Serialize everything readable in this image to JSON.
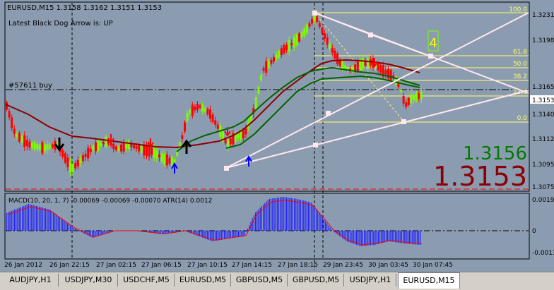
{
  "chart_header": {
    "symbol_line": "EURUSD,M15  1.3158 1.3162 1.3151 1.3153",
    "indicator_text": "Latest Black Dog Arrow is:  UP",
    "order_label": "#57611 buy"
  },
  "price_axis": {
    "ticks": [
      "1.3231",
      "1.3198",
      "1.3165",
      "1.3140",
      "1.3112",
      "1.3095",
      "1.3075"
    ],
    "current_price_tag": "1.3153"
  },
  "big_prices": {
    "bid": "1.3156",
    "ask": "1.3153"
  },
  "fibonacci": {
    "levels": [
      "100.0",
      "61.8",
      "50.0",
      "38.2",
      "23.6",
      "0.0"
    ]
  },
  "wave_label": "4",
  "macd_panel": {
    "label": "MACD(10, 20, 1, 7) -0.00069 -0.00069 -0.00070  ATR(14) 0.0012",
    "ticks": [
      "0.0019",
      "0",
      "-0.0013"
    ]
  },
  "time_axis": {
    "labels": [
      "26 Jan 2012",
      "26 Jan 22:15",
      "27 Jan 02:15",
      "27 Jan 06:15",
      "27 Jan 10:15",
      "27 Jan 14:15",
      "27 Jan 18:15",
      "29 Jan 23:45",
      "30 Jan 03:45",
      "30 Jan 07:45"
    ]
  },
  "tabs": [
    {
      "label": "AUDJPY,H1",
      "active": false
    },
    {
      "label": "USDJPY,M30",
      "active": false
    },
    {
      "label": "USDCHF,M5",
      "active": false
    },
    {
      "label": "EURUSD,M5",
      "active": false
    },
    {
      "label": "GBPUSD,M5",
      "active": false
    },
    {
      "label": "GBPUSD,M5",
      "active": false
    },
    {
      "label": "USDJPY,H1",
      "active": false
    },
    {
      "label": "EURUSD,M15",
      "active": true
    }
  ],
  "colors": {
    "background": "#8c9cb0",
    "bull": "#7cfc00",
    "bear": "#ff0000",
    "ma_fast": "#008000",
    "ma_slow": "#8b0000",
    "fib": "#ffff66",
    "trendline": "#ffe8f0"
  }
}
